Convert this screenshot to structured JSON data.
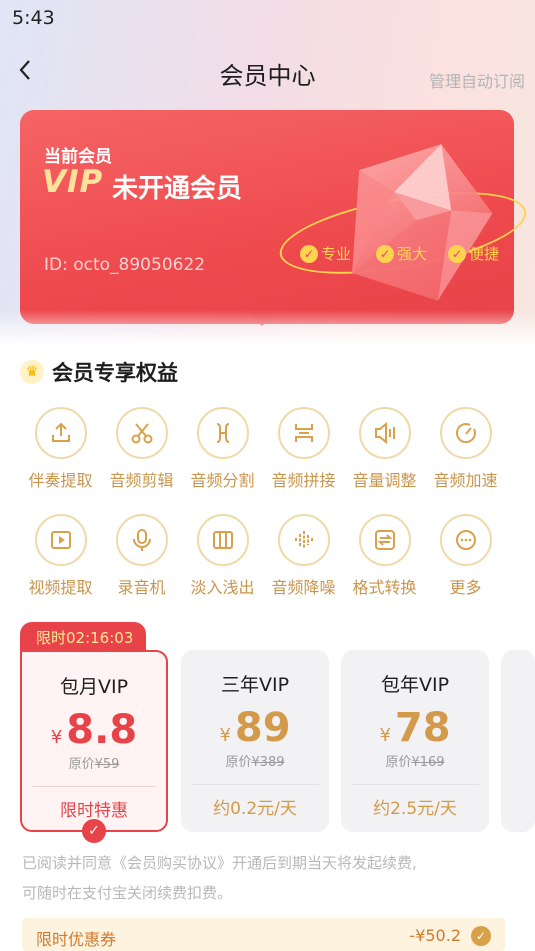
{
  "status_bar": {
    "time": "5:43"
  },
  "nav": {
    "back_icon": "chevron-left-icon",
    "title": "会员中心",
    "right_action": "管理自动订阅"
  },
  "vip_card": {
    "current_label": "当前会员",
    "vip_logo": "VIP",
    "status": "未开通会员",
    "user_id": "ID: octo_89050622",
    "features": [
      "专业",
      "强大",
      "便捷"
    ],
    "accent_color": "#e84348",
    "gold_color": "#ffd24f"
  },
  "benefits": {
    "title": "会员专享权益",
    "items": [
      {
        "label": "伴奏提取",
        "icon": "upload-icon"
      },
      {
        "label": "音频剪辑",
        "icon": "scissors-icon"
      },
      {
        "label": "音频分割",
        "icon": "split-icon"
      },
      {
        "label": "音频拼接",
        "icon": "merge-icon"
      },
      {
        "label": "音量调整",
        "icon": "volume-icon"
      },
      {
        "label": "音频加速",
        "icon": "speed-icon"
      },
      {
        "label": "视频提取",
        "icon": "video-icon"
      },
      {
        "label": "录音机",
        "icon": "microphone-icon"
      },
      {
        "label": "淡入浅出",
        "icon": "fade-icon"
      },
      {
        "label": "音频降噪",
        "icon": "noise-reduction-icon"
      },
      {
        "label": "格式转换",
        "icon": "convert-icon"
      },
      {
        "label": "更多",
        "icon": "more-icon"
      }
    ]
  },
  "plans": {
    "timer": "限时02:16:03",
    "items": [
      {
        "name": "包月VIP",
        "currency": "¥",
        "price": "8.8",
        "orig_label": "原价",
        "orig_price": "¥59",
        "tag": "限时特惠",
        "selected": true
      },
      {
        "name": "三年VIP",
        "currency": "¥",
        "price": "89",
        "orig_label": "原价",
        "orig_price": "¥389",
        "tag": "约0.2元/天",
        "selected": false
      },
      {
        "name": "包年VIP",
        "currency": "¥",
        "price": "78",
        "orig_label": "原价",
        "orig_price": "¥169",
        "tag": "约2.5元/天",
        "selected": false
      }
    ]
  },
  "agreement": {
    "line1": "已阅读并同意《会员购买协议》开通后到期当天将发起续费,",
    "line2": "可随时在支付宝关闭续费扣费。"
  },
  "coupon": {
    "label": "限时优惠券",
    "amount": "-¥50.2"
  }
}
